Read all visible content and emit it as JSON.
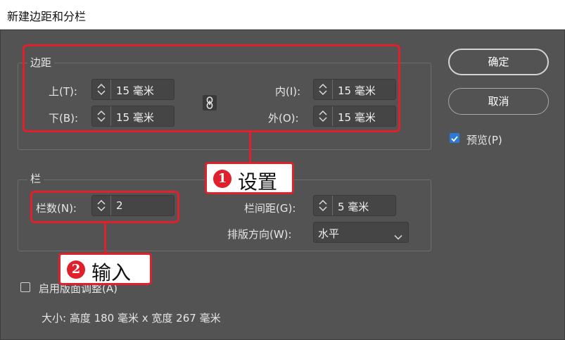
{
  "window": {
    "title": "新建边距和分栏"
  },
  "margins": {
    "group_label": "边距",
    "top": {
      "label": "上(T):",
      "value": "15 毫米"
    },
    "bottom": {
      "label": "下(B):",
      "value": "15 毫米"
    },
    "inside": {
      "label": "内(I):",
      "value": "15 毫米"
    },
    "outside": {
      "label": "外(O):",
      "value": "15 毫米"
    }
  },
  "columns": {
    "group_label": "栏",
    "number": {
      "label": "栏数(N):",
      "value": "2"
    },
    "gutter": {
      "label": "栏间距(G):",
      "value": "5 毫米"
    },
    "direction": {
      "label": "排版方向(W):",
      "value": "水平"
    }
  },
  "buttons": {
    "ok": "确定",
    "cancel": "取消"
  },
  "preview": {
    "label": "预览(P)",
    "checked": true
  },
  "layout_adjust": {
    "label": "启用版面调整(A)",
    "checked": false
  },
  "size_info": "大小: 高度 180 毫米 x 宽度 267 毫米",
  "annotations": {
    "callout1": {
      "number": "1",
      "text": "设置"
    },
    "callout2": {
      "number": "2",
      "text": "输入"
    }
  },
  "colors": {
    "accent_red": "#e0202a",
    "checkbox_blue": "#2d7ad6",
    "dialog_bg": "#535353"
  }
}
